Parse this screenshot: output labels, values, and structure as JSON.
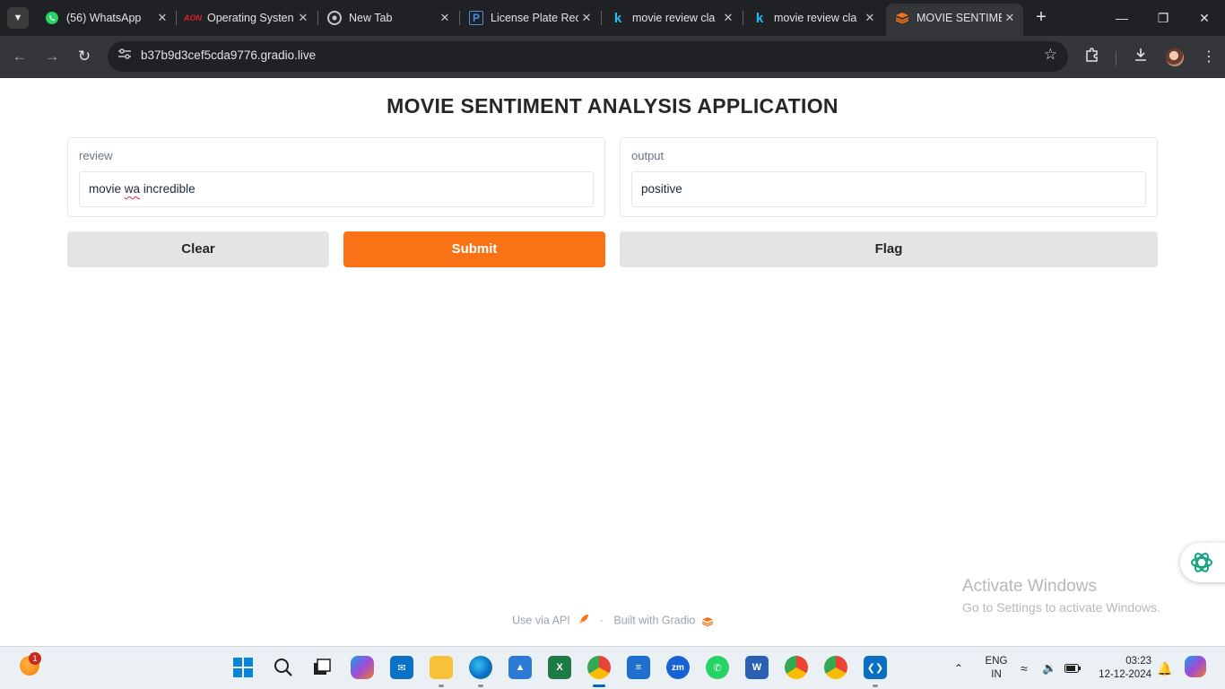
{
  "browser": {
    "tab_list_icon": "chevron-down-icon",
    "tabs": [
      {
        "title": "(56) WhatsApp",
        "favicon": "whatsapp-icon",
        "active": false
      },
      {
        "title": "Operating Systen",
        "favicon": "aon-icon",
        "active": false
      },
      {
        "title": "New Tab",
        "favicon": "chrome-icon",
        "active": false
      },
      {
        "title": "License Plate Rec",
        "favicon": "p-icon",
        "active": false
      },
      {
        "title": "movie review cla",
        "favicon": "kaggle-icon",
        "active": false
      },
      {
        "title": "movie review cla",
        "favicon": "kaggle-icon",
        "active": false
      },
      {
        "title": "MOVIE SENTIME",
        "favicon": "gradio-icon",
        "active": true
      }
    ],
    "url": "b37b9d3cef5cda9776.gradio.live"
  },
  "app": {
    "title": "MOVIE SENTIMENT ANALYSIS APPLICATION",
    "review": {
      "label": "review",
      "value_word1": "movie",
      "value_word2": "wa",
      "value_word3": "incredible"
    },
    "output": {
      "label": "output",
      "value": "positive"
    },
    "buttons": {
      "clear": "Clear",
      "submit": "Submit",
      "flag": "Flag"
    },
    "footer": {
      "api": "Use via API",
      "separator": "·",
      "built": "Built with Gradio"
    }
  },
  "watermark": {
    "line1": "Activate Windows",
    "line2": "Go to Settings to activate Windows."
  },
  "taskbar": {
    "weather_badge": "1",
    "language": "ENG",
    "region": "IN",
    "time": "03:23",
    "date": "12-12-2024"
  },
  "colors": {
    "accent": "#f97316",
    "secondary_button": "#e4e4e7",
    "chrome_dark": "#202124",
    "chrome_mid": "#35363a"
  }
}
